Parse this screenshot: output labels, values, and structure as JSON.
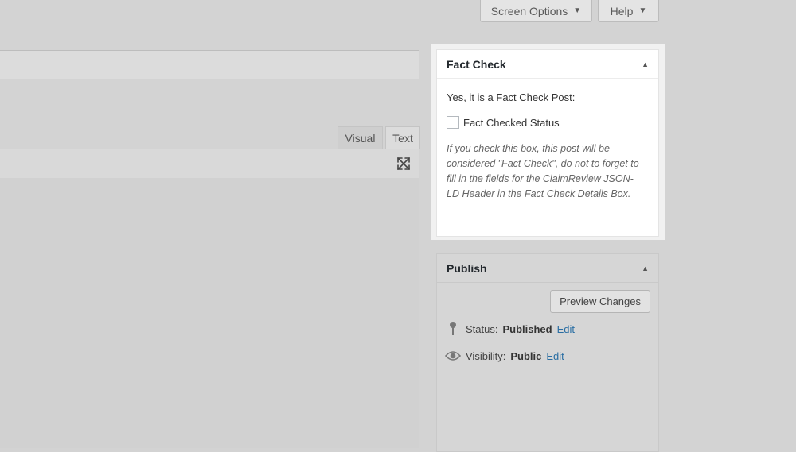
{
  "toolbar": {
    "screen_options_label": "Screen Options",
    "help_label": "Help"
  },
  "editor": {
    "tabs": [
      {
        "label": "Visual"
      },
      {
        "label": "Text"
      }
    ]
  },
  "fact_check": {
    "title": "Fact Check",
    "intro": "Yes, it is a Fact Check Post:",
    "checkbox_label": "Fact Checked Status",
    "checkbox_checked": false,
    "note": "If you check this box, this post will be considered \"Fact Check\", do not to forget to fill in the fields for the ClaimReview JSON-LD Header in the Fact Check Details Box."
  },
  "publish": {
    "title": "Publish",
    "preview_label": "Preview Changes",
    "status_label": "Status:",
    "status_value": "Published",
    "status_edit": "Edit",
    "visibility_label": "Visibility:",
    "visibility_value": "Public",
    "visibility_edit": "Edit"
  }
}
